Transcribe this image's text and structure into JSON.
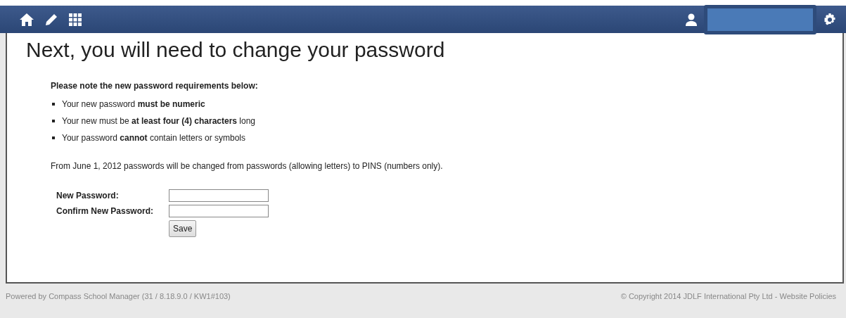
{
  "heading": "Next, you will need to change your password",
  "note_title": "Please note the new password requirements below:",
  "requirements": [
    "Your new password **must be numeric**",
    "Your new must be **at least four (4) characters** long",
    "Your password **cannot** contain letters or symbols"
  ],
  "info": "From June 1, 2012 passwords will be changed from passwords (allowing letters) to PINS (numbers only).",
  "fields": [
    {
      "label": "New Password:"
    },
    {
      "label": "Confirm New Password:"
    }
  ],
  "save_button": "Save",
  "footer": {
    "powered": "Powered by Compass School Manager (31 / 8.18.9.0 / KW1#103)",
    "copyright": "© Copyright 2014 JDLF International Pty Ltd - ",
    "policies_link": "Website Policies"
  }
}
